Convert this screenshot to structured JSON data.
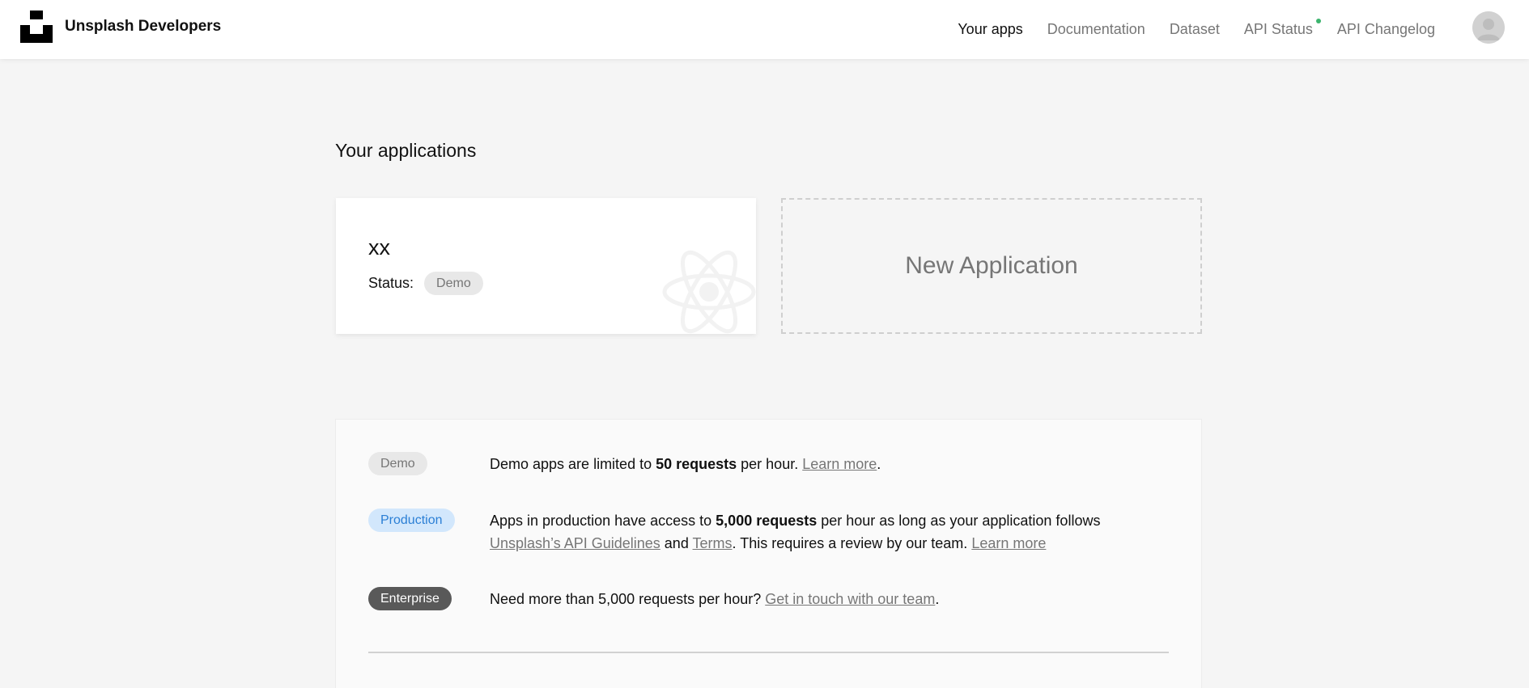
{
  "header": {
    "brand": "Unsplash Developers",
    "nav": {
      "your_apps": "Your apps",
      "documentation": "Documentation",
      "dataset": "Dataset",
      "api_status": "API Status",
      "api_changelog": "API Changelog"
    },
    "status_dot_color": "#3cb46e"
  },
  "main": {
    "title": "Your applications",
    "app": {
      "name": "xx",
      "status_label": "Status:",
      "status_value": "Demo"
    },
    "new_app_label": "New Application"
  },
  "tiers": {
    "demo": {
      "badge": "Demo",
      "text_before": "Demo apps are limited to ",
      "bold": "50 requests",
      "text_after": " per hour. ",
      "link": "Learn more",
      "end": "."
    },
    "production": {
      "badge": "Production",
      "text_before": "Apps in production have access to ",
      "bold": "5,000 requests",
      "text_middle": " per hour as long as your application follows ",
      "link_guidelines": "Unsplash’s API Guidelines",
      "and": " and ",
      "link_terms": "Terms",
      "text_after": ". This requires a review by our team. ",
      "link_learn": "Learn more"
    },
    "enterprise": {
      "badge": "Enterprise",
      "text_before": "Need more than 5,000 requests per hour? ",
      "link": "Get in touch with our team",
      "end": "."
    }
  }
}
